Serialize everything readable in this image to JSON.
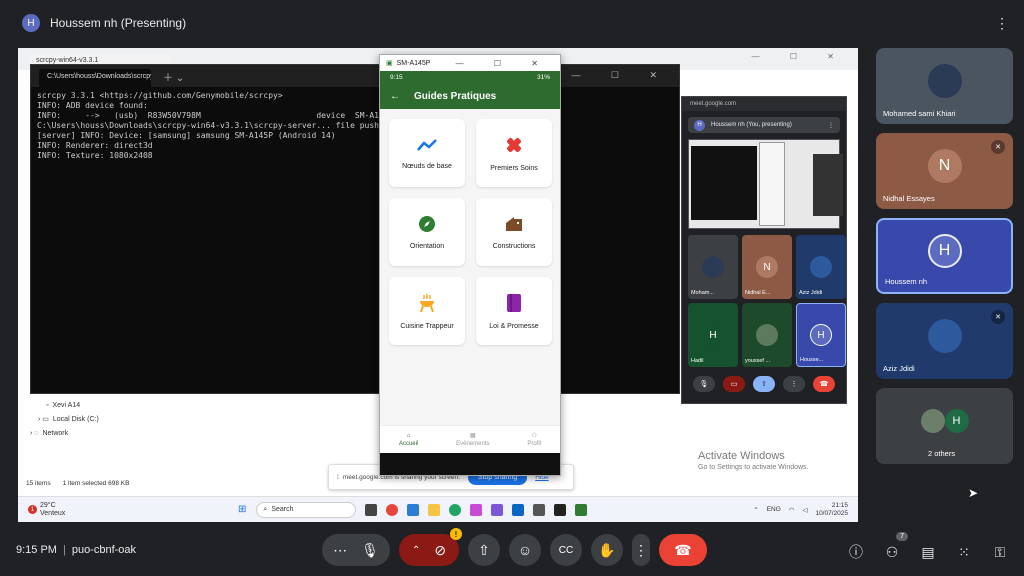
{
  "topbar": {
    "avatar_initial": "H",
    "title": "Houssem nh (Presenting)"
  },
  "explorer": {
    "tab": "scrcpy-win64-v3.3.1",
    "tree": [
      "Xevi A14",
      "Local Disk (C:)",
      "Network"
    ],
    "status_items": "15 items",
    "status_selected": "1 item selected  698 KB"
  },
  "terminal": {
    "tab_title": "C:\\Users\\houss\\Downloads\\scrcpy",
    "lines": "scrcpy 3.3.1 <https://github.com/Genymobile/scrcpy>\nINFO: ADB device found:\nINFO:     -->   (usb)  R83W50V798M                        device  SM-A145P\nC:\\Users\\houss\\Downloads\\scrcpy-win64-v3.3.1\\scrcpy-server... file pushed, 0 skipped. 88 bytes in 0.004s)\n[server] INFO: Device: [samsung] samsung SM-A145P (Android 14)\nINFO: Renderer: direct3d\nINFO: Texture: 1080x2408"
  },
  "activate": {
    "title": "Activate Windows",
    "subtitle": "Go to Settings to activate Windows."
  },
  "sharebar": {
    "message": "meet.google.com is sharing your screen.",
    "stop_label": "Stop sharing",
    "hide_label": "Hide"
  },
  "taskbar": {
    "weather_badge": "1",
    "temp": "29°C",
    "weather": "Venteux",
    "search": "Search",
    "lang": "ENG",
    "time": "21:15",
    "date": "10/07/2025"
  },
  "phone": {
    "window_title": "SM-A145P",
    "status_time": "9:15",
    "battery": "31%",
    "app_title": "Guides Pratiques",
    "cards": [
      {
        "label": "Nœuds de base",
        "color": "#1a73e8"
      },
      {
        "label": "Premiers Soins",
        "color": "#e53935"
      },
      {
        "label": "Orientation",
        "color": "#2e7d32"
      },
      {
        "label": "Constructions",
        "color": "#7b4b2a"
      },
      {
        "label": "Cuisine Trappeur",
        "color": "#f9a825"
      },
      {
        "label": "Loi & Promesse",
        "color": "#8e24aa"
      }
    ],
    "nav": [
      "Accueil",
      "Evènements",
      "Profil"
    ]
  },
  "meet_mini": {
    "url": "meet.google.com",
    "presenting": "Houssem nh (You, presenting)",
    "tiles": [
      {
        "name": "Moham...",
        "initial": "",
        "bg": "#3c4043"
      },
      {
        "name": "Nidhal E...",
        "initial": "N",
        "bg": "#8d5a46"
      },
      {
        "name": "Aziz Jdidi",
        "initial": "",
        "bg": "#1f3a6b"
      },
      {
        "name": "Hadil",
        "initial": "H",
        "bg": "#14532d"
      },
      {
        "name": "youssef ...",
        "initial": "",
        "bg": "#1e4a2c"
      },
      {
        "name": "Housse...",
        "initial": "H",
        "bg": "#3949ab"
      }
    ]
  },
  "participants": [
    {
      "name": "Mohamed sami Khiari",
      "initial": "",
      "bg": "#4a5560",
      "avatar_bg": "#2b3a55",
      "muted": false
    },
    {
      "name": "Nidhal Essayes",
      "initial": "N",
      "bg": "#8d5a46",
      "avatar_bg": "#b07a62",
      "muted": true
    },
    {
      "name": "Houssem nh",
      "initial": "H",
      "bg": "#3949ab",
      "avatar_bg": "#5c6bc0",
      "muted": false
    },
    {
      "name": "Aziz Jdidi",
      "initial": "",
      "bg": "#1f3a6b",
      "avatar_bg": "#2d5a9c",
      "muted": true
    },
    {
      "name": "2 others",
      "initial": "H",
      "bg": "#3c4043",
      "avatar_bg": "#1e6b46",
      "muted": false
    }
  ],
  "meeting": {
    "time": "9:15 PM",
    "code": "puo-cbnf-oak"
  },
  "people_count": "7",
  "warn_mark": "!"
}
